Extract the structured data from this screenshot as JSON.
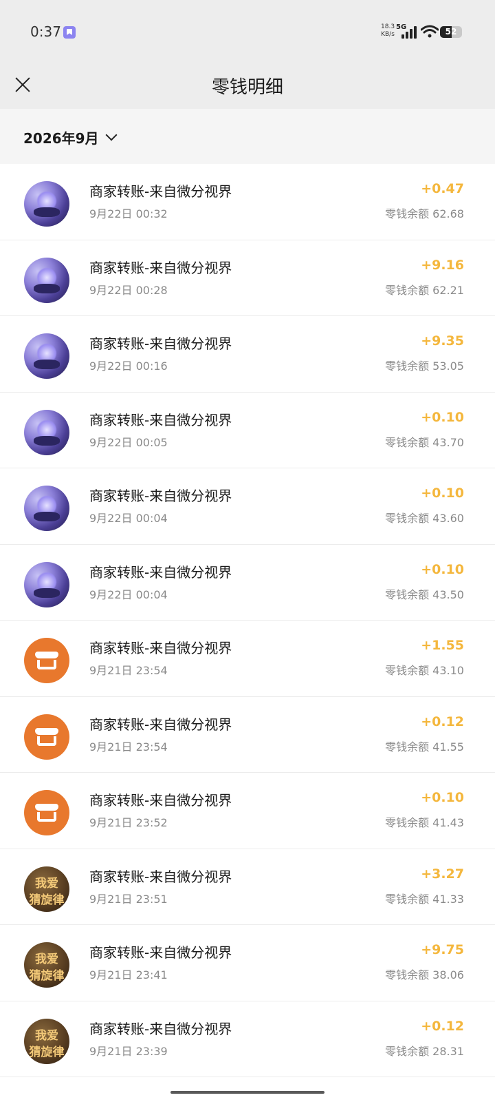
{
  "status_bar": {
    "time": "0:37",
    "net_speed_value": "18.3",
    "net_speed_unit": "KB/s",
    "network_type": "5G",
    "battery": "52"
  },
  "header": {
    "title": "零钱明细",
    "close_icon": "close-icon"
  },
  "filter": {
    "month": "2026年9月"
  },
  "transactions": [
    {
      "title": "商家转账-来自微分视界",
      "time": "9月22日 00:32",
      "amount": "+0.47",
      "balance": "零钱余额 62.68",
      "avatar": "butterfly"
    },
    {
      "title": "商家转账-来自微分视界",
      "time": "9月22日 00:28",
      "amount": "+9.16",
      "balance": "零钱余额 62.21",
      "avatar": "butterfly"
    },
    {
      "title": "商家转账-来自微分视界",
      "time": "9月22日 00:16",
      "amount": "+9.35",
      "balance": "零钱余额 53.05",
      "avatar": "butterfly"
    },
    {
      "title": "商家转账-来自微分视界",
      "time": "9月22日 00:05",
      "amount": "+0.10",
      "balance": "零钱余额 43.70",
      "avatar": "butterfly"
    },
    {
      "title": "商家转账-来自微分视界",
      "time": "9月22日 00:04",
      "amount": "+0.10",
      "balance": "零钱余额 43.60",
      "avatar": "butterfly"
    },
    {
      "title": "商家转账-来自微分视界",
      "time": "9月22日 00:04",
      "amount": "+0.10",
      "balance": "零钱余额 43.50",
      "avatar": "butterfly"
    },
    {
      "title": "商家转账-来自微分视界",
      "time": "9月21日 23:54",
      "amount": "+1.55",
      "balance": "零钱余额 43.10",
      "avatar": "store"
    },
    {
      "title": "商家转账-来自微分视界",
      "time": "9月21日 23:54",
      "amount": "+0.12",
      "balance": "零钱余额 41.55",
      "avatar": "store"
    },
    {
      "title": "商家转账-来自微分视界",
      "time": "9月21日 23:52",
      "amount": "+0.10",
      "balance": "零钱余额 41.43",
      "avatar": "store"
    },
    {
      "title": "商家转账-来自微分视界",
      "time": "9月21日 23:51",
      "amount": "+3.27",
      "balance": "零钱余额 41.33",
      "avatar": "text"
    },
    {
      "title": "商家转账-来自微分视界",
      "time": "9月21日 23:41",
      "amount": "+9.75",
      "balance": "零钱余额 38.06",
      "avatar": "text"
    },
    {
      "title": "商家转账-来自微分视界",
      "time": "9月21日 23:39",
      "amount": "+0.12",
      "balance": "零钱余额 28.31",
      "avatar": "text"
    }
  ],
  "avatar_text": {
    "line1": "我爱",
    "line2": "猜旋律"
  },
  "colors": {
    "amount": "#f4b73d",
    "header_bg": "#ededed",
    "store_avatar": "#e8782d"
  }
}
